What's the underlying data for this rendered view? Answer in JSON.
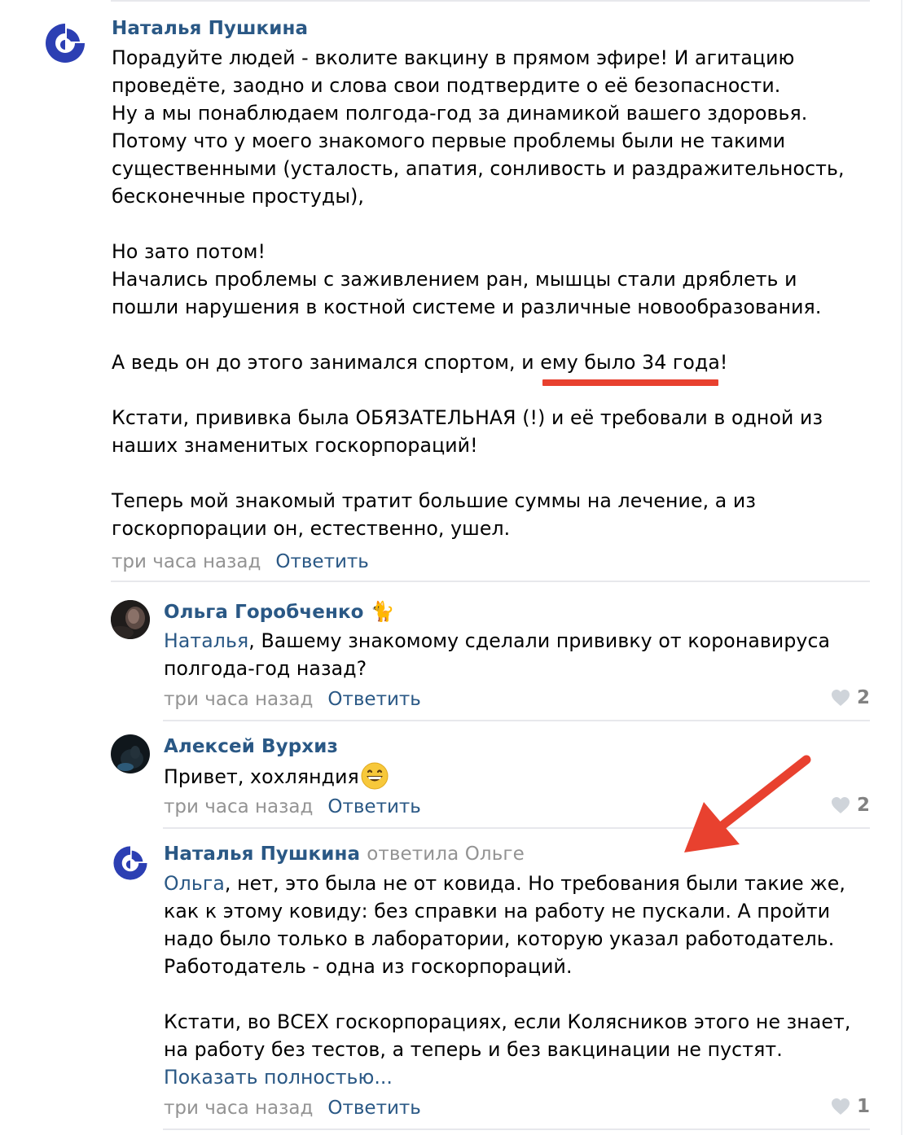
{
  "comments": [
    {
      "author": "Наталья Пушкина",
      "text": "Порадуйте людей - вколите вакцину в прямом эфире! И агитацию\nпроведёте, заодно и слова свои подтвердите о её безопасности.\nНу а мы понаблюдаем полгода-год за динамикой вашего здоровья.\nПотому что у моего знакомого первые проблемы были не такими\nсущественными (усталость, апатия, сонливость и раздражительность,\nбесконечные простуды),\n\nНо зато потом!\nНачались проблемы с заживлением ран, мышцы стали дряблеть и\nпошли нарушения в костной системе и различные новообразования.\n\nА ведь он до этого занимался спортом, и ему было 34 года!\n\nКстати, прививка была ОБЯЗАТЕЛЬНАЯ (!) и её требовали в одной из\nнаших знаменитых госкорпораций!\n\nТеперь мой знакомый тратит большие суммы на лечение, а из\nгоскорпорации он, естественно, ушел.",
      "time": "три часа назад",
      "reply_label": "Ответить"
    },
    {
      "author": "Ольга Горобченко",
      "author_emoji": "🐈",
      "mention": "Наталья",
      "text": ", Вашему знакомому сделали прививку от коронавируса\nполгода-год назад?",
      "time": "три часа назад",
      "reply_label": "Ответить",
      "likes": "2"
    },
    {
      "author": "Алексей Вурхиз",
      "text": "Привет, хохляндия",
      "time": "три часа назад",
      "reply_label": "Ответить",
      "likes": "2"
    },
    {
      "author": "Наталья Пушкина",
      "reply_to": "ответила Ольге",
      "mention": "Ольга",
      "text": ", нет, это была не от ковида. Но требования были такие же,\nкак к этому ковиду: без справки на работу не пускали. А пройти\nнадо было только в лаборатории, которую указал работодатель.\nРаботодатель - одна из госкорпораций.\n\nКстати, во ВСЕХ госкорпорациях, если Колясников этого не знает,\nна работу без тестов, а теперь и без вакцинации не пустят.",
      "show_more": "Показать полностью...",
      "time": "три часа назад",
      "reply_label": "Ответить",
      "likes": "1"
    }
  ],
  "colors": {
    "link": "#2a5885",
    "muted": "#939393",
    "separator": "#e7e8ec",
    "annotation": "#e8412f"
  },
  "icons": [
    "vk-community-logo-icon",
    "heart-icon",
    "grinning-emoji-icon",
    "red-arrow-annotation"
  ]
}
